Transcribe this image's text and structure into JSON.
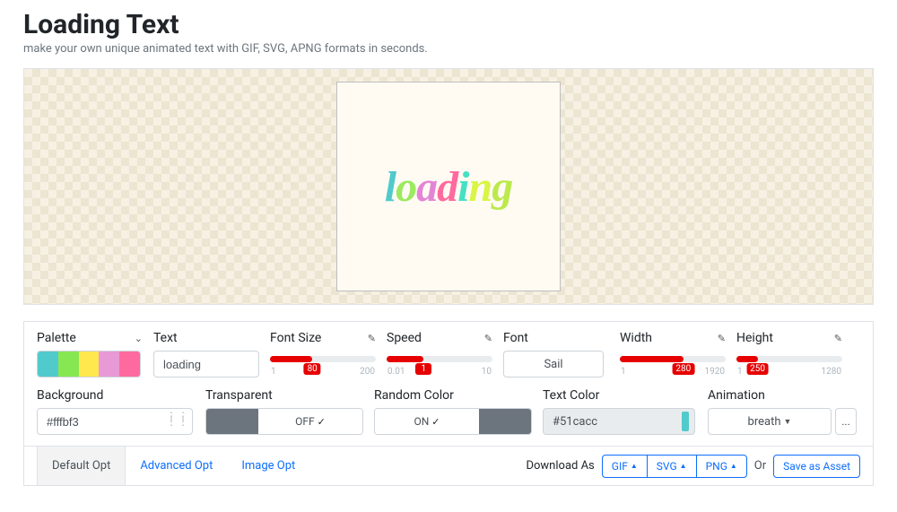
{
  "title": "Loading Text",
  "subtitle": "make your own unique animated text with GIF, SVG, APNG formats in seconds.",
  "preview_text": "loading",
  "panel": {
    "palette": {
      "label": "Palette"
    },
    "text": {
      "label": "Text",
      "value": "loading"
    },
    "fontsize": {
      "label": "Font Size",
      "value": "80",
      "min": "1",
      "max": "200",
      "pct": 40
    },
    "speed": {
      "label": "Speed",
      "value": "1",
      "min": "0.01",
      "max": "10",
      "pct": 35
    },
    "font": {
      "label": "Font",
      "value": "Sail"
    },
    "width": {
      "label": "Width",
      "value": "280",
      "min": "1",
      "max": "1920",
      "pct": 60
    },
    "height": {
      "label": "Height",
      "value": "250",
      "min": "1",
      "max": "1280",
      "pct": 20
    },
    "background": {
      "label": "Background",
      "value": "#fffbf3"
    },
    "transparent": {
      "label": "Transparent",
      "value": "OFF"
    },
    "randomcolor": {
      "label": "Random Color",
      "value": "ON"
    },
    "textcolor": {
      "label": "Text Color",
      "value": "#51cacc"
    },
    "animation": {
      "label": "Animation",
      "value": "breath"
    }
  },
  "tabs": {
    "default": "Default Opt",
    "advanced": "Advanced Opt",
    "image": "Image Opt"
  },
  "download": {
    "label": "Download As",
    "gif": "GIF",
    "svg": "SVG",
    "png": "PNG",
    "or": "Or",
    "save": "Save as Asset"
  }
}
